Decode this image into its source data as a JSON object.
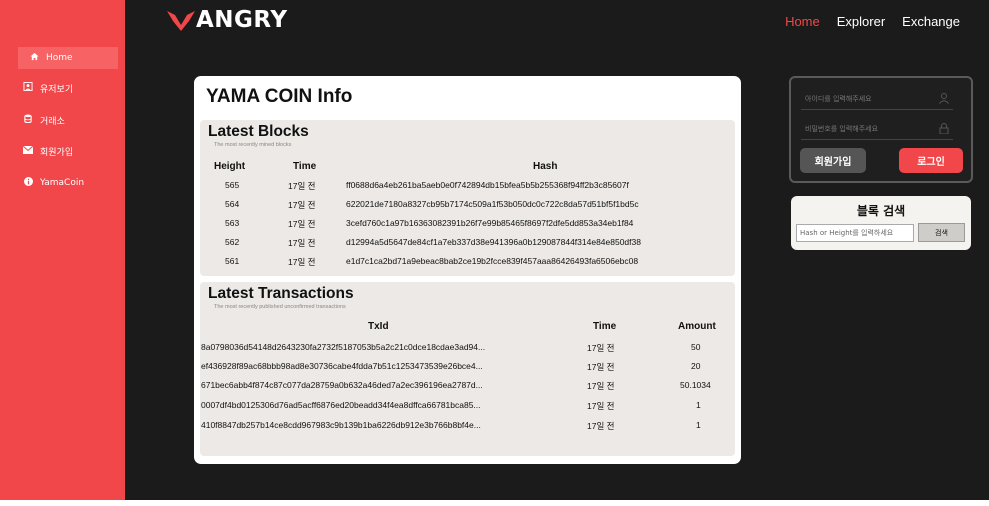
{
  "sidebar": {
    "items": [
      {
        "icon": "home-icon",
        "label": "Home"
      },
      {
        "icon": "user-icon",
        "label": "유저보기"
      },
      {
        "icon": "database-icon",
        "label": "거래소"
      },
      {
        "icon": "mail-icon",
        "label": "회원가입"
      },
      {
        "icon": "info-icon",
        "label": "YamaCoin"
      }
    ]
  },
  "header": {
    "logo_text": "ANGRY",
    "nav": [
      "Home",
      "Explorer",
      "Exchange"
    ]
  },
  "info": {
    "title": "YAMA COIN Info",
    "blocks": {
      "title": "Latest Blocks",
      "subtitle": "The most recently mined blocks",
      "headers": [
        "Height",
        "Time",
        "Hash"
      ],
      "rows": [
        {
          "height": "565",
          "time": "17일 전",
          "hash": "ff0688d6a4eb261ba5aeb0e0f742894db15bfea5b5b255368f94ff2b3c85607f"
        },
        {
          "height": "564",
          "time": "17일 전",
          "hash": "622021de7180a8327cb95b7174c509a1f53b050dc0c722c8da57d51bf5f1bd5c"
        },
        {
          "height": "563",
          "time": "17일 전",
          "hash": "3cefd760c1a97b16363082391b26f7e99b85465f8697f2dfe5dd853a34eb1f84"
        },
        {
          "height": "562",
          "time": "17일 전",
          "hash": "d12994a5d5647de84cf1a7eb337d38e941396a0b129087844f314e84e850df38"
        },
        {
          "height": "561",
          "time": "17일 전",
          "hash": "e1d7c1ca2bd71a9ebeac8bab2ce19b2fcce839f457aaa86426493fa6506ebc08"
        }
      ]
    },
    "transactions": {
      "title": "Latest Transactions",
      "subtitle": "The most recently published unconfirmed transactions",
      "headers": [
        "TxId",
        "Time",
        "Amount"
      ],
      "rows": [
        {
          "txid": "8a0798036d54148d2643230fa2732f5187053b5a2c21c0dce18cdae3ad94...",
          "time": "17일 전",
          "amount": "50"
        },
        {
          "txid": "ef436928f89ac68bbb98ad8e30736cabe4fdda7b51c1253473539e26bce4...",
          "time": "17일 전",
          "amount": "20"
        },
        {
          "txid": "671bec6abb4f874c87c077da28759a0b632a46ded7a2ec396196ea2787d...",
          "time": "17일 전",
          "amount": "50.1034"
        },
        {
          "txid": "0007df4bd0125306d76ad5acff6876ed20beadd34f4ea8dffca66781bca85...",
          "time": "17일 전",
          "amount": "1"
        },
        {
          "txid": "410f8847db257b14ce8cdd967983c9b139b1ba6226db912e3b766b8bf4e...",
          "time": "17일 전",
          "amount": "1"
        }
      ]
    }
  },
  "login": {
    "id_placeholder": "아이디를 입력해주세요",
    "pw_placeholder": "비밀번호를 입력해주세요",
    "signup_label": "회원가입",
    "login_label": "로그인"
  },
  "search": {
    "title": "블록 검색",
    "placeholder": "Hash or Height를 입력하세요",
    "button_label": "검색"
  },
  "colors": {
    "accent": "#f2474a",
    "background": "#1b1b1b",
    "panel": "#ffffff",
    "section": "#ece9e6"
  }
}
